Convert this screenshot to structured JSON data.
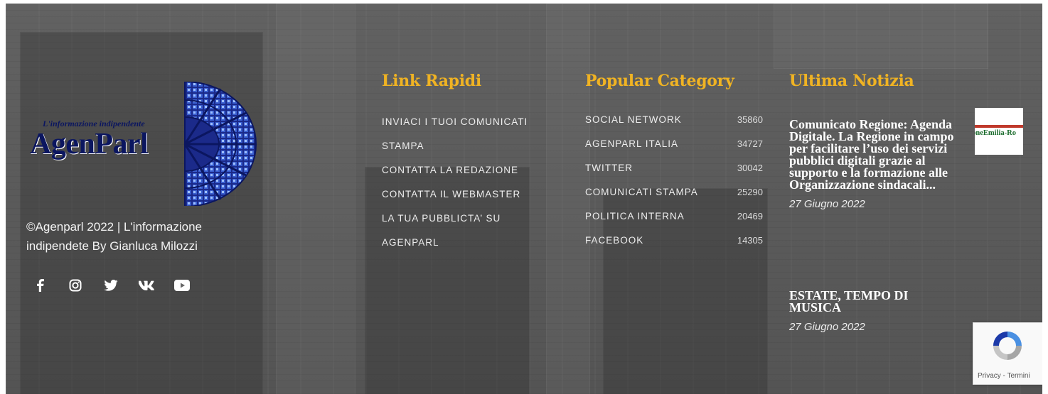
{
  "brand": {
    "tagline": "L'informazione indipendente",
    "name": "AgenParl"
  },
  "copyright": "©Agenparl 2022 | L'informazione indipendete By Gianluca Milozzi",
  "social": [
    "facebook-icon",
    "instagram-icon",
    "twitter-icon",
    "vk-icon",
    "youtube-icon"
  ],
  "link_rapidi": {
    "title": "Link Rapidi",
    "items": [
      "INVIACI I TUOI COMUNICATI STAMPA",
      "CONTATTA LA REDAZIONE",
      "CONTATTA IL WEBMASTER",
      "LA TUA PUBBLICTA’ SU AGENPARL"
    ]
  },
  "popular_category": {
    "title": "Popular Category",
    "items": [
      {
        "name": "SOCIAL NETWORK",
        "count": "35860"
      },
      {
        "name": "AGENPARL ITALIA",
        "count": "34727"
      },
      {
        "name": "TWITTER",
        "count": "30042"
      },
      {
        "name": "COMUNICATI STAMPA",
        "count": "25290"
      },
      {
        "name": "POLITICA INTERNA",
        "count": "20469"
      },
      {
        "name": "FACEBOOK",
        "count": "14305"
      }
    ]
  },
  "ultima_notizia": {
    "title": "Ultima Notizia",
    "items": [
      {
        "title": "Comunicato Regione: Agenda Digitale. La Regione in campo per facilitare l’uso dei servizi pubblici digitali grazie al supporto e la formazione alle Organizzazione sindacali...",
        "date": "27 Giugno 2022",
        "thumb_text": "gioneEmilia-Ro"
      },
      {
        "title": "ESTATE, TEMPO DI MUSICA",
        "date": "27 Giugno 2022"
      }
    ]
  },
  "recaptcha": {
    "text": "Privacy - Termini"
  },
  "colors": {
    "accent": "#f0b323",
    "background": "#666666"
  }
}
